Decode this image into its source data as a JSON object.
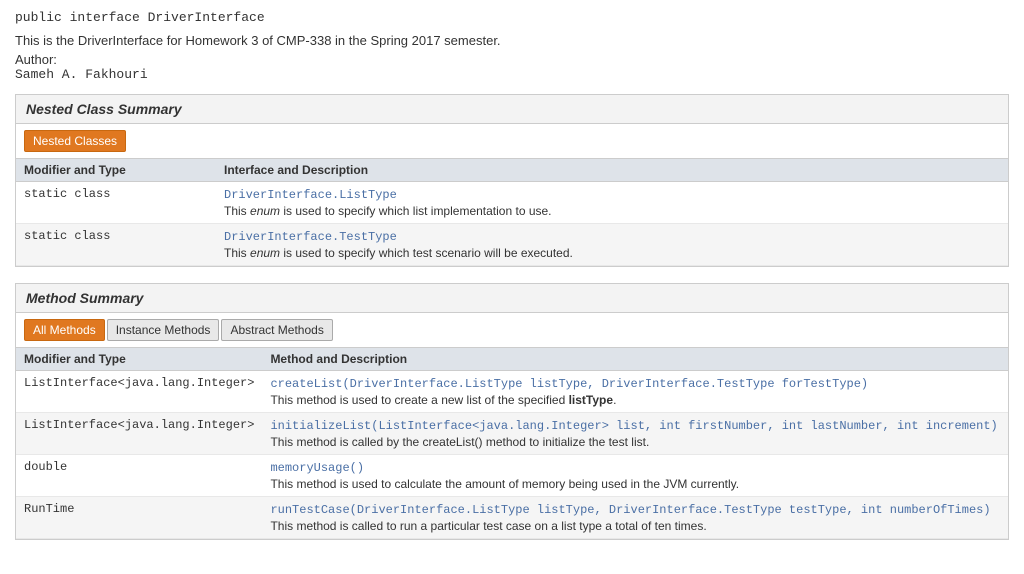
{
  "header": {
    "code": "public interface DriverInterface",
    "description": "This is the DriverInterface for Homework 3 of CMP-338 in the Spring 2017 semester.",
    "author_label": "Author:",
    "author_name": "Sameh A. Fakhouri"
  },
  "nested_class_summary": {
    "title": "Nested Class Summary",
    "tab_label": "Nested Classes",
    "col1": "Modifier and Type",
    "col2": "Interface and Description",
    "rows": [
      {
        "modifier": "static class",
        "link": "DriverInterface.ListType",
        "desc_prefix": "This ",
        "desc_italic": "enum",
        "desc_suffix": " is used to specify which list implementation to use."
      },
      {
        "modifier": "static class",
        "link": "DriverInterface.TestType",
        "desc_prefix": "This ",
        "desc_italic": "enum",
        "desc_suffix": " is used to specify which test scenario will be executed."
      }
    ]
  },
  "method_summary": {
    "title": "Method Summary",
    "tabs": [
      {
        "label": "All Methods",
        "active": true
      },
      {
        "label": "Instance Methods",
        "active": false
      },
      {
        "label": "Abstract Methods",
        "active": false
      }
    ],
    "col1": "Modifier and Type",
    "col2": "Method and Description",
    "rows": [
      {
        "modifier": "ListInterface<java.lang.Integer>",
        "link": "createList",
        "link_text": "createList(DriverInterface.ListType listType, DriverInterface.TestType forTestType)",
        "desc": "This method is used to create a new list of the specified ",
        "desc_bold": "listType",
        "desc_suffix": "."
      },
      {
        "modifier": "ListInterface<java.lang.Integer>",
        "link": "initializeList",
        "link_text": "initializeList(ListInterface<java.lang.Integer> list, int firstNumber, int lastNumber, int increment)",
        "desc": "This method is called by the createList() method to initialize the test list.",
        "desc_bold": "",
        "desc_suffix": ""
      },
      {
        "modifier": "double",
        "link": "memoryUsage",
        "link_text": "memoryUsage()",
        "desc": "This method is used to calculate the amount of memory being used in the JVM currently.",
        "desc_bold": "",
        "desc_suffix": ""
      },
      {
        "modifier": "RunTime",
        "link": "runTestCase",
        "link_text": "runTestCase(DriverInterface.ListType listType, DriverInterface.TestType testType, int numberOfTimes)",
        "desc": "This method is called to run a particular test case on a list type a total of ten times.",
        "desc_bold": "",
        "desc_suffix": ""
      }
    ]
  }
}
